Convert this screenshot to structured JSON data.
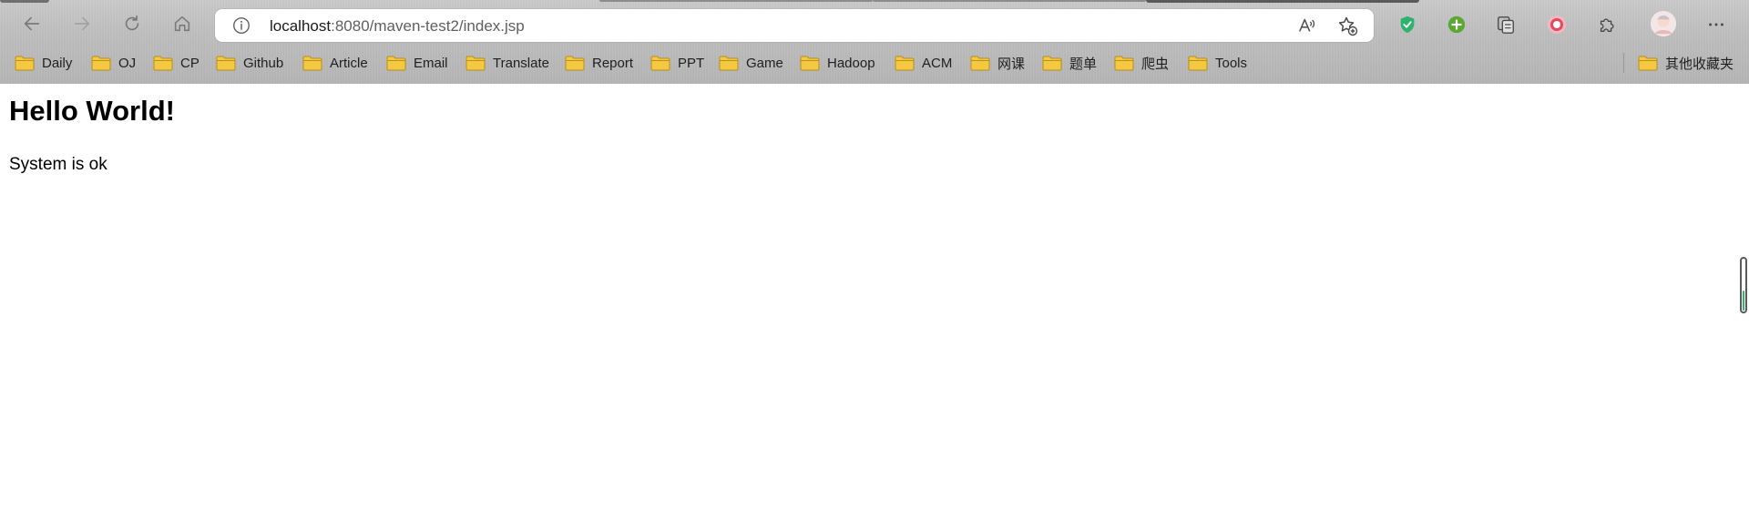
{
  "browser": {
    "address": {
      "host": "localhost",
      "path": ":8080/maven-test2/index.jsp"
    },
    "nav_icons": [
      "back-arrow-icon",
      "forward-arrow-icon",
      "refresh-icon",
      "home-icon"
    ],
    "address_icons": [
      "info-icon",
      "read-aloud-icon",
      "add-favorite-icon"
    ],
    "extension_icons": [
      "shield-check-icon",
      "plus-circle-icon",
      "collections-icon",
      "red-circle-icon",
      "puzzle-icon",
      "avatar",
      "more-icon"
    ],
    "bookmarks": [
      {
        "label": "Daily"
      },
      {
        "label": "OJ"
      },
      {
        "label": "CP"
      },
      {
        "label": "Github"
      },
      {
        "label": "Article"
      },
      {
        "label": "Email"
      },
      {
        "label": "Translate"
      },
      {
        "label": "Report"
      },
      {
        "label": "PPT"
      },
      {
        "label": "Game"
      },
      {
        "label": "Hadoop"
      },
      {
        "label": "ACM"
      },
      {
        "label": "网课"
      },
      {
        "label": "题单"
      },
      {
        "label": "爬虫"
      },
      {
        "label": "Tools"
      }
    ],
    "other_bookmarks": "其他收藏夹",
    "colors": {
      "folder": "#f5c842",
      "shield": "#2db36b",
      "plus": "#5aa832",
      "accent": "#2db36b"
    }
  },
  "page": {
    "heading": "Hello World!",
    "text": "System is ok"
  }
}
